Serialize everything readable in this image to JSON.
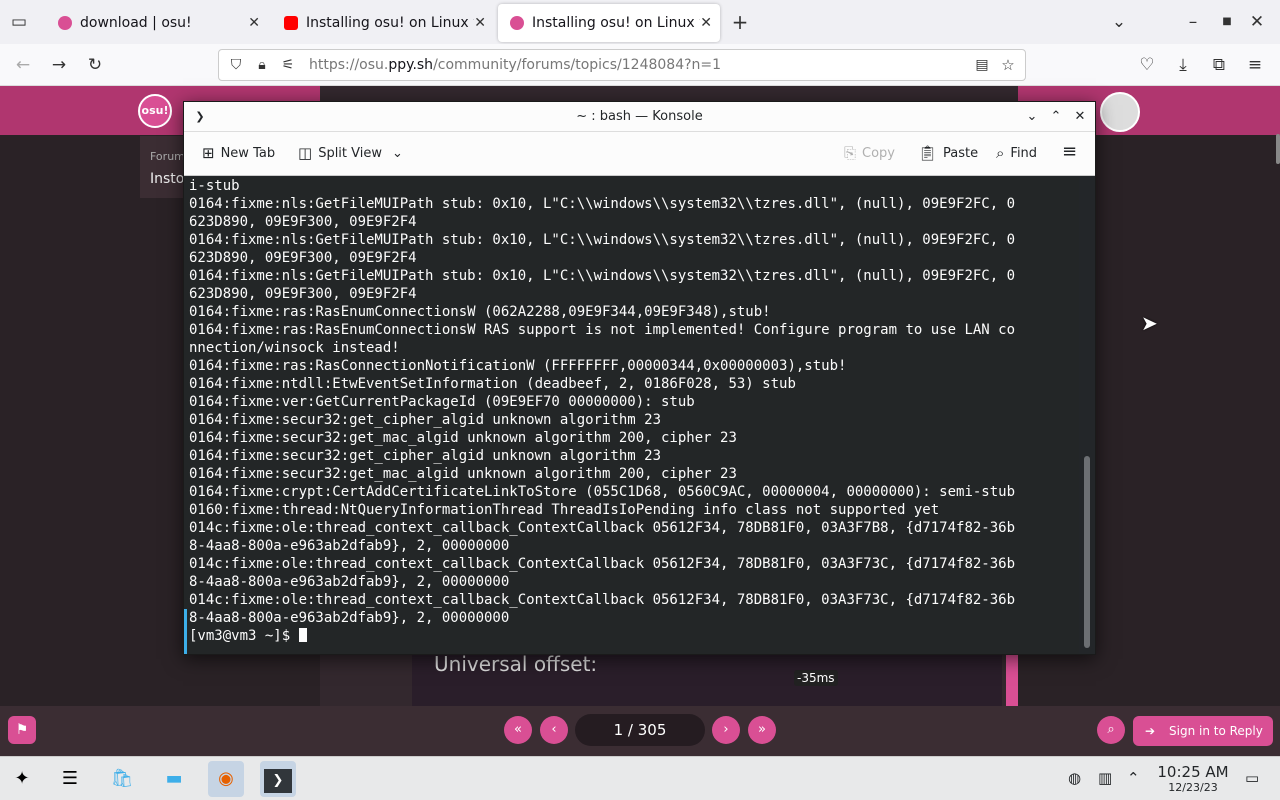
{
  "browser": {
    "tabs": [
      {
        "title": "download | osu!",
        "favicon_color": "#d94f94",
        "active": false
      },
      {
        "title": "Installing osu! on Linux w",
        "favicon_color": "#ff0000",
        "active": false
      },
      {
        "title": "Installing osu! on Linux w",
        "favicon_color": "#d94f94",
        "active": true
      }
    ],
    "new_tab_label": "+",
    "url_prefix": "https://osu.",
    "url_domain": "ppy.sh",
    "url_path": "/community/forums/topics/1248084?n=1"
  },
  "page": {
    "logo_text": "osu!",
    "breadcrumb": "Forum",
    "title_fragment": "Insto",
    "offset_label": "Universal offset:",
    "offset_value": "-35ms",
    "pager": {
      "current": "1",
      "separator": "/",
      "total": "305"
    },
    "reply_label": "Sign in to Reply"
  },
  "konsole": {
    "title": "~ : bash — Konsole",
    "toolbar": {
      "new_tab": "New Tab",
      "split_view": "Split View",
      "copy": "Copy",
      "paste": "Paste",
      "find": "Find"
    },
    "lines": [
      "i-stub",
      "0164:fixme:nls:GetFileMUIPath stub: 0x10, L\"C:\\\\windows\\\\system32\\\\tzres.dll\", (null), 09E9F2FC, 0",
      "623D890, 09E9F300, 09E9F2F4",
      "0164:fixme:nls:GetFileMUIPath stub: 0x10, L\"C:\\\\windows\\\\system32\\\\tzres.dll\", (null), 09E9F2FC, 0",
      "623D890, 09E9F300, 09E9F2F4",
      "0164:fixme:nls:GetFileMUIPath stub: 0x10, L\"C:\\\\windows\\\\system32\\\\tzres.dll\", (null), 09E9F2FC, 0",
      "623D890, 09E9F300, 09E9F2F4",
      "0164:fixme:ras:RasEnumConnectionsW (062A2288,09E9F344,09E9F348),stub!",
      "0164:fixme:ras:RasEnumConnectionsW RAS support is not implemented! Configure program to use LAN co",
      "nnection/winsock instead!",
      "0164:fixme:ras:RasConnectionNotificationW (FFFFFFFF,00000344,0x00000003),stub!",
      "0164:fixme:ntdll:EtwEventSetInformation (deadbeef, 2, 0186F028, 53) stub",
      "0164:fixme:ver:GetCurrentPackageId (09E9EF70 00000000): stub",
      "0164:fixme:secur32:get_cipher_algid unknown algorithm 23",
      "0164:fixme:secur32:get_mac_algid unknown algorithm 200, cipher 23",
      "0164:fixme:secur32:get_cipher_algid unknown algorithm 23",
      "0164:fixme:secur32:get_mac_algid unknown algorithm 200, cipher 23",
      "0164:fixme:crypt:CertAddCertificateLinkToStore (055C1D68, 0560C9AC, 00000004, 00000000): semi-stub",
      "0160:fixme:thread:NtQueryInformationThread ThreadIsIoPending info class not supported yet",
      "014c:fixme:ole:thread_context_callback_ContextCallback 05612F34, 78DB81F0, 03A3F7B8, {d7174f82-36b",
      "8-4aa8-800a-e963ab2dfab9}, 2, 00000000",
      "014c:fixme:ole:thread_context_callback_ContextCallback 05612F34, 78DB81F0, 03A3F73C, {d7174f82-36b",
      "8-4aa8-800a-e963ab2dfab9}, 2, 00000000",
      "014c:fixme:ole:thread_context_callback_ContextCallback 05612F34, 78DB81F0, 03A3F73C, {d7174f82-36b",
      "8-4aa8-800a-e963ab2dfab9}, 2, 00000000"
    ],
    "prompt": "[vm3@vm3 ~]$ "
  },
  "taskbar": {
    "time": "10:25 AM",
    "date": "12/23/23"
  },
  "colors": {
    "osu_pink": "#d94f94",
    "osu_header": "#b0366f",
    "konsole_bg": "#232627",
    "selection_marker": "#3daee9"
  }
}
